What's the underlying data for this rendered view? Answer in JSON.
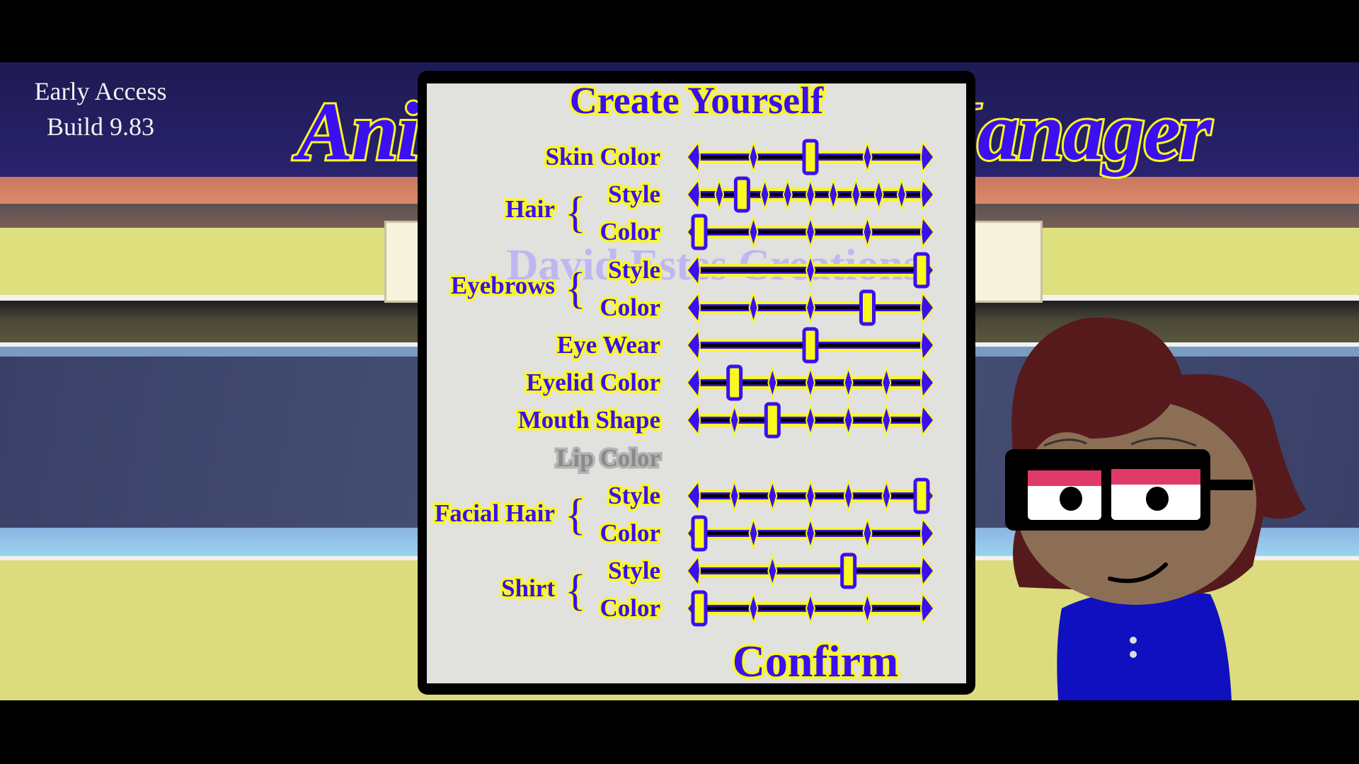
{
  "build": {
    "line1": "Early Access",
    "line2": "Build 9.83"
  },
  "game_title": "Animation Studio Manager",
  "banner_text": "David Estes Creations",
  "panel": {
    "title": "Create Yourself",
    "groups": {
      "hair": "Hair",
      "eyebrows": "Eyebrows",
      "facial_hair": "Facial Hair",
      "shirt": "Shirt"
    },
    "rows": [
      {
        "label": "Skin Color",
        "steps": 5,
        "value": 2
      },
      {
        "label": "Style",
        "steps": 11,
        "value": 2
      },
      {
        "label": "Color",
        "steps": 5,
        "value": 0
      },
      {
        "label": "Style",
        "steps": 3,
        "value": 2
      },
      {
        "label": "Color",
        "steps": 5,
        "value": 3
      },
      {
        "label": "Eye Wear",
        "steps": 3,
        "value": 1
      },
      {
        "label": "Eyelid Color",
        "steps": 7,
        "value": 1
      },
      {
        "label": "Mouth Shape",
        "steps": 7,
        "value": 2
      },
      {
        "label": "Lip Color",
        "disabled": true
      },
      {
        "label": "Style",
        "steps": 7,
        "value": 6
      },
      {
        "label": "Color",
        "steps": 5,
        "value": 0
      },
      {
        "label": "Style",
        "steps": 4,
        "value": 2
      },
      {
        "label": "Color",
        "steps": 5,
        "value": 0
      }
    ],
    "confirm_label": "Confirm"
  },
  "colors": {
    "text_blue": "#3a10f0",
    "outline_yellow": "#f8f820",
    "hair": "#561a1c",
    "skin": "#8c6e54",
    "shirt": "#1010c0",
    "eyelid": "#e03a68"
  }
}
